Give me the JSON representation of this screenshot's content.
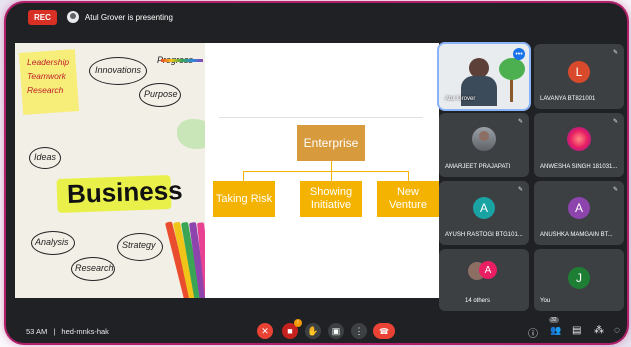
{
  "meeting": {
    "rec_label": "REC",
    "presenting_text": "Atul Grover is presenting",
    "time": "53 AM",
    "meeting_code": "hed-mnks-hak",
    "separator": "|",
    "people_count": "32"
  },
  "slide": {
    "photo_words": {
      "leadership": "Leadership",
      "teamwork": "Teamwork",
      "research_top": "Research",
      "innovations": "Innovations",
      "progress": "Progress",
      "purpose": "Purpose",
      "ideas": "Ideas",
      "business": "Business",
      "analysis": "Analysis",
      "research": "Research",
      "strategy": "Strategy"
    },
    "top": "Enterprise",
    "children": [
      "Taking Risk",
      "Showing Initiative",
      "New Venture"
    ]
  },
  "participants": [
    {
      "name": "Atul Grover",
      "self_view": true
    },
    {
      "name": "LAVANYA BT821001",
      "initial": "L",
      "color": "#d84a2b"
    },
    {
      "name": "AMARJEET PRAJAPATI",
      "photo": true
    },
    {
      "name": "ANWESHA SINGH 181031...",
      "photo": true
    },
    {
      "name": "AYUSH RASTOGI BTG101...",
      "initial": "A",
      "color": "#1aa3a3"
    },
    {
      "name": "ANUSHKA MAMGAIN BT...",
      "initial": "A",
      "color": "#8e44ad"
    },
    {
      "name": "14 others",
      "initial": "A",
      "color": "#e91e63"
    },
    {
      "name": "You",
      "initial": "J",
      "color": "#1e7e34"
    }
  ]
}
